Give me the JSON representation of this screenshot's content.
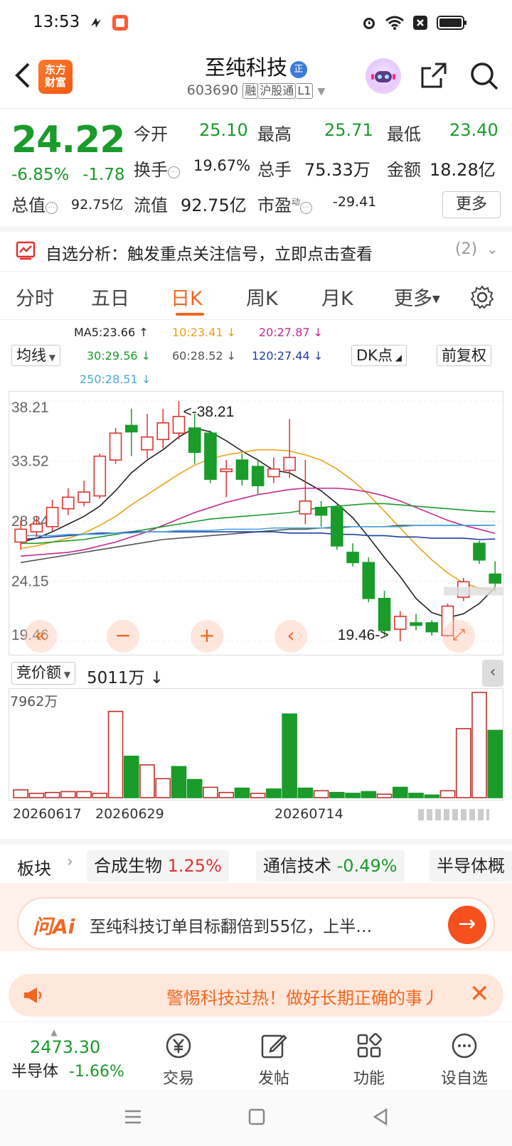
{
  "status": {
    "time": "13:53"
  },
  "header": {
    "logo_line1": "东方",
    "logo_line2": "财富",
    "name": "至纯科技",
    "name_badge": "正",
    "code": "603690",
    "tag_rong": "融",
    "tag_hgt": "沪股通",
    "tag_level": "L1"
  },
  "quote": {
    "price": "24.22",
    "change_pct": "-6.85%",
    "change": "-1.78",
    "open_label": "今开",
    "open": "25.10",
    "high_label": "最高",
    "high": "25.71",
    "low_label": "最低",
    "low": "23.40",
    "turnover_label": "换手",
    "turnover": "19.67%",
    "volume_label": "总手",
    "volume": "75.33万",
    "amount_label": "金额",
    "amount": "18.28亿",
    "mcap_label": "总值",
    "mcap": "92.75亿",
    "float_label": "流值",
    "float": "92.75亿",
    "pe_label": "市盈",
    "pe_sup": "动",
    "pe": "-29.41",
    "more": "更多"
  },
  "alert": {
    "text": "自选分析：触发重点关注信号，立即点击查看",
    "count": "(2)"
  },
  "tabs": [
    {
      "label": "分时"
    },
    {
      "label": "五日"
    },
    {
      "label": "日K"
    },
    {
      "label": "周K"
    },
    {
      "label": "月K"
    },
    {
      "label": "更多"
    }
  ],
  "ma": {
    "ma5": "MA5:23.66",
    "ma10": "10:23.41",
    "ma20": "20:27.87",
    "ma30": "30:29.56",
    "ma60": "60:28.52",
    "ma120": "120:27.44",
    "ma250": "250:28.51",
    "colors": {
      "ma5": "#222222",
      "ma10": "#e8a317",
      "ma20": "#c2298f",
      "ma30": "#1a9b2a",
      "ma60": "#555555",
      "ma120": "#1f3ea8",
      "ma250": "#4aa8d8"
    }
  },
  "controls": {
    "avg_line": "均线",
    "dk": "DK点",
    "adjust": "前复权"
  },
  "chart_data": {
    "type": "candlestick",
    "y_ticks": [
      "38.21",
      "33.52",
      "28.84",
      "24.15",
      "19.46"
    ],
    "ylim": [
      19.46,
      38.21
    ],
    "max_label": "<-38.21",
    "min_label": "19.46->",
    "candles": [
      {
        "o": 27.2,
        "c": 28.2,
        "h": 28.9,
        "l": 26.6
      },
      {
        "o": 28.0,
        "c": 28.6,
        "h": 29.2,
        "l": 27.6
      },
      {
        "o": 28.4,
        "c": 29.9,
        "h": 30.5,
        "l": 28.0
      },
      {
        "o": 29.8,
        "c": 30.7,
        "h": 31.4,
        "l": 29.3
      },
      {
        "o": 30.3,
        "c": 31.1,
        "h": 32.0,
        "l": 30.0
      },
      {
        "o": 30.8,
        "c": 33.9,
        "h": 34.1,
        "l": 30.6
      },
      {
        "o": 33.6,
        "c": 35.7,
        "h": 36.1,
        "l": 33.3
      },
      {
        "o": 36.3,
        "c": 35.8,
        "h": 37.6,
        "l": 33.9
      },
      {
        "o": 34.4,
        "c": 35.4,
        "h": 37.2,
        "l": 33.7
      },
      {
        "o": 35.2,
        "c": 36.5,
        "h": 37.6,
        "l": 34.5
      },
      {
        "o": 35.7,
        "c": 37.0,
        "h": 38.21,
        "l": 35.2
      },
      {
        "o": 36.1,
        "c": 34.2,
        "h": 37.2,
        "l": 33.3
      },
      {
        "o": 35.7,
        "c": 32.1,
        "h": 35.9,
        "l": 31.8
      },
      {
        "o": 32.7,
        "c": 32.9,
        "h": 33.6,
        "l": 30.7
      },
      {
        "o": 33.6,
        "c": 32.1,
        "h": 34.1,
        "l": 31.6
      },
      {
        "o": 33.1,
        "c": 31.6,
        "h": 33.6,
        "l": 30.9
      },
      {
        "o": 32.3,
        "c": 32.9,
        "h": 33.8,
        "l": 31.8
      },
      {
        "o": 32.8,
        "c": 33.8,
        "h": 36.8,
        "l": 32.2
      },
      {
        "o": 29.4,
        "c": 30.4,
        "h": 33.6,
        "l": 28.6
      },
      {
        "o": 29.9,
        "c": 29.3,
        "h": 30.4,
        "l": 28.4
      },
      {
        "o": 29.9,
        "c": 26.9,
        "h": 30.1,
        "l": 26.6
      },
      {
        "o": 26.4,
        "c": 25.6,
        "h": 27.1,
        "l": 25.3
      },
      {
        "o": 25.6,
        "c": 22.8,
        "h": 26.0,
        "l": 22.5
      },
      {
        "o": 22.8,
        "c": 20.3,
        "h": 23.4,
        "l": 19.9
      },
      {
        "o": 20.4,
        "c": 21.4,
        "h": 21.8,
        "l": 19.46
      },
      {
        "o": 20.9,
        "c": 20.7,
        "h": 21.6,
        "l": 20.3
      },
      {
        "o": 20.9,
        "c": 20.2,
        "h": 21.1,
        "l": 19.9
      },
      {
        "o": 19.9,
        "c": 22.2,
        "h": 22.4,
        "l": 19.8
      },
      {
        "o": 22.9,
        "c": 24.1,
        "h": 24.4,
        "l": 22.6
      },
      {
        "o": 27.1,
        "c": 25.8,
        "h": 27.3,
        "l": 25.5
      },
      {
        "o": 24.7,
        "c": 24.0,
        "h": 25.7,
        "l": 23.4
      }
    ],
    "ma_lines": [
      {
        "name": "MA5",
        "color": "#222222",
        "values": [
          27.2,
          27.5,
          28.0,
          28.6,
          29.2,
          30.0,
          31.2,
          32.6,
          33.6,
          34.4,
          35.4,
          36.1,
          35.8,
          35.1,
          34.3,
          33.6,
          32.8,
          32.6,
          31.9,
          31.2,
          30.2,
          29.1,
          27.6,
          26.0,
          24.5,
          22.8,
          21.7,
          21.3,
          21.6,
          22.4,
          23.66
        ]
      },
      {
        "name": "MA10",
        "color": "#e8a317",
        "values": [
          26.7,
          26.9,
          27.2,
          27.5,
          27.9,
          28.5,
          29.2,
          30.1,
          30.9,
          31.7,
          32.5,
          33.2,
          33.7,
          34.0,
          34.2,
          34.4,
          34.4,
          34.3,
          34.0,
          33.6,
          32.9,
          32.0,
          30.9,
          29.6,
          28.3,
          27.0,
          25.8,
          24.8,
          24.0,
          23.6,
          23.41
        ]
      },
      {
        "name": "MA20",
        "color": "#c2298f",
        "values": [
          26.1,
          26.2,
          26.3,
          26.4,
          26.6,
          26.9,
          27.2,
          27.6,
          28.0,
          28.5,
          29.0,
          29.5,
          29.9,
          30.3,
          30.6,
          30.9,
          31.1,
          31.3,
          31.4,
          31.4,
          31.4,
          31.3,
          31.1,
          30.8,
          30.4,
          29.9,
          29.4,
          28.9,
          28.5,
          28.2,
          27.87
        ]
      },
      {
        "name": "MA30",
        "color": "#1a9b2a",
        "values": [
          27.1,
          27.1,
          27.2,
          27.3,
          27.4,
          27.6,
          27.8,
          28.0,
          28.2,
          28.4,
          28.6,
          28.8,
          29.0,
          29.1,
          29.2,
          29.3,
          29.4,
          29.5,
          29.7,
          29.9,
          30.0,
          30.1,
          30.2,
          30.2,
          30.1,
          30.0,
          29.9,
          29.8,
          29.7,
          29.6,
          29.56
        ]
      },
      {
        "name": "MA60",
        "color": "#555555",
        "values": [
          25.6,
          25.8,
          26.0,
          26.2,
          26.4,
          26.6,
          26.8,
          27.0,
          27.2,
          27.4,
          27.5,
          27.6,
          27.7,
          27.8,
          27.9,
          28.0,
          28.1,
          28.2,
          28.2,
          28.3,
          28.3,
          28.4,
          28.4,
          28.4,
          28.5,
          28.5,
          28.5,
          28.5,
          28.5,
          28.5,
          28.52
        ]
      },
      {
        "name": "MA120",
        "color": "#1f3ea8",
        "values": [
          27.4,
          27.5,
          27.6,
          27.7,
          27.8,
          27.9,
          27.9,
          28.0,
          28.0,
          28.0,
          28.0,
          28.0,
          28.0,
          28.0,
          28.0,
          28.0,
          28.0,
          27.9,
          27.9,
          27.9,
          27.8,
          27.8,
          27.7,
          27.7,
          27.6,
          27.6,
          27.5,
          27.5,
          27.5,
          27.4,
          27.44
        ]
      },
      {
        "name": "MA250",
        "color": "#4aa8d8",
        "values": [
          27.7,
          27.7,
          27.7,
          27.8,
          27.8,
          27.8,
          27.9,
          27.9,
          28.0,
          28.0,
          28.1,
          28.1,
          28.1,
          28.2,
          28.2,
          28.2,
          28.3,
          28.3,
          28.3,
          28.3,
          28.4,
          28.4,
          28.4,
          28.4,
          28.4,
          28.5,
          28.5,
          28.5,
          28.5,
          28.5,
          28.51
        ]
      }
    ]
  },
  "volume": {
    "label": "竞价额",
    "value": "5011万 ↓",
    "max_label": "7962万",
    "dates": [
      "20260617",
      "20260629",
      "20260714"
    ],
    "bars": [
      {
        "v": 9,
        "up": true
      },
      {
        "v": 5,
        "up": true
      },
      {
        "v": 6,
        "up": true
      },
      {
        "v": 7,
        "up": true
      },
      {
        "v": 7,
        "up": true
      },
      {
        "v": 5,
        "up": true
      },
      {
        "v": 100,
        "up": true
      },
      {
        "v": 48,
        "up": false
      },
      {
        "v": 38,
        "up": true
      },
      {
        "v": 22,
        "up": true
      },
      {
        "v": 36,
        "up": false
      },
      {
        "v": 21,
        "up": false
      },
      {
        "v": 12,
        "up": true
      },
      {
        "v": 6,
        "up": true
      },
      {
        "v": 11,
        "up": false
      },
      {
        "v": 5,
        "up": true
      },
      {
        "v": 10,
        "up": false
      },
      {
        "v": 97,
        "up": false
      },
      {
        "v": 11,
        "up": false
      },
      {
        "v": 8,
        "up": true
      },
      {
        "v": 6,
        "up": false
      },
      {
        "v": 5,
        "up": false
      },
      {
        "v": 7,
        "up": false
      },
      {
        "v": 4,
        "up": true
      },
      {
        "v": 12,
        "up": false
      },
      {
        "v": 5,
        "up": false
      },
      {
        "v": 3,
        "up": false
      },
      {
        "v": 8,
        "up": true
      },
      {
        "v": 80,
        "up": true
      },
      {
        "v": 122,
        "up": true
      },
      {
        "v": 78,
        "up": false
      }
    ]
  },
  "sector": {
    "label": "板块",
    "items": [
      {
        "name": "合成生物",
        "pct": "1.25%",
        "up": true
      },
      {
        "name": "通信技术",
        "pct": "-0.49%",
        "up": false
      },
      {
        "name": "半导体概",
        "pct": "",
        "up": true
      }
    ]
  },
  "ai": {
    "logo": "问Ai",
    "text": "至纯科技订单目标翻倍到55亿，上半…"
  },
  "warning": {
    "text": "警惕科技过热！做好长期正确的事丿"
  },
  "bottom": {
    "index_value": "2473.30",
    "index_name": "半导体",
    "index_change": "-1.66%",
    "items": [
      {
        "label": "交易"
      },
      {
        "label": "发帖"
      },
      {
        "label": "功能"
      },
      {
        "label": "设自选"
      }
    ]
  }
}
